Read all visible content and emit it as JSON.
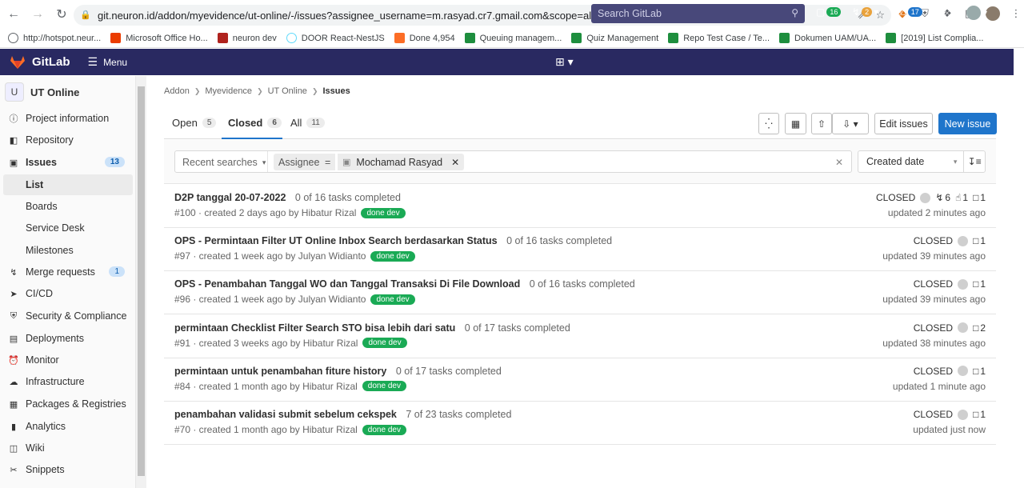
{
  "browser": {
    "url": "git.neuron.id/addon/myevidence/ut-online/-/issues?assignee_username=m.rasyad.cr7.gmail.com&scope=all&sort=created_date&state=closed",
    "bookmarks": [
      {
        "label": "http://hotspot.neur...",
        "color": "#5f6368"
      },
      {
        "label": "Microsoft Office Ho...",
        "color": "#eb3c00"
      },
      {
        "label": "neuron dev",
        "color": "#b0231e"
      },
      {
        "label": "DOOR React-NestJS",
        "color": "#61dafb"
      },
      {
        "label": "Done 4,954",
        "color": "#fc6d26"
      },
      {
        "label": "Queuing managem...",
        "color": "#1e8e3e"
      },
      {
        "label": "Quiz Management",
        "color": "#1e8e3e"
      },
      {
        "label": "Repo Test Case / Te...",
        "color": "#1e8e3e"
      },
      {
        "label": "Dokumen UAM/UA...",
        "color": "#1e8e3e"
      },
      {
        "label": "[2019] List Complia...",
        "color": "#1e8e3e"
      }
    ]
  },
  "header": {
    "brand": "GitLab",
    "menu": "Menu",
    "search_placeholder": "Search GitLab",
    "issues_count": "16",
    "mr_count": "2",
    "todo_count": "17",
    "colors": {
      "bg": "#292961",
      "green": "#1aaa55",
      "orange": "#e9a23b",
      "blue": "#1f75cb"
    }
  },
  "sidebar": {
    "project_initial": "U",
    "project_name": "UT Online",
    "items": [
      {
        "label": "Project information",
        "icon": "info-icon"
      },
      {
        "label": "Repository",
        "icon": "repo-icon"
      },
      {
        "label": "Issues",
        "icon": "issues-icon",
        "badge": "13"
      },
      {
        "label": "Merge requests",
        "icon": "merge-request-icon",
        "badge": "1"
      },
      {
        "label": "CI/CD",
        "icon": "rocket-icon"
      },
      {
        "label": "Security & Compliance",
        "icon": "shield-icon"
      },
      {
        "label": "Deployments",
        "icon": "deployments-icon"
      },
      {
        "label": "Monitor",
        "icon": "monitor-icon"
      },
      {
        "label": "Infrastructure",
        "icon": "cloud-icon"
      },
      {
        "label": "Packages & Registries",
        "icon": "package-icon"
      },
      {
        "label": "Analytics",
        "icon": "chart-icon"
      },
      {
        "label": "Wiki",
        "icon": "book-icon"
      },
      {
        "label": "Snippets",
        "icon": "scissors-icon"
      }
    ],
    "issues_sub": [
      "List",
      "Boards",
      "Service Desk",
      "Milestones"
    ]
  },
  "breadcrumb": [
    "Addon",
    "Myevidence",
    "UT Online",
    "Issues"
  ],
  "tabs": [
    {
      "label": "Open",
      "count": "5"
    },
    {
      "label": "Closed",
      "count": "6"
    },
    {
      "label": "All",
      "count": "11"
    }
  ],
  "actions": {
    "edit": "Edit issues",
    "new": "New issue"
  },
  "filter": {
    "recent": "Recent searches",
    "token_key": "Assignee",
    "token_op": "=",
    "token_value": "Mochamad Rasyad",
    "sort": "Created date"
  },
  "issues": [
    {
      "title": "D2P tanggal 20-07-2022",
      "tasks": "0 of 16 tasks completed",
      "meta": "#100 · created 2 days ago by Hibatur Rizal",
      "label": "done dev",
      "status": "CLOSED",
      "mrs": "6",
      "upvotes": "1",
      "comments": "1",
      "updated": "updated 2 minutes ago"
    },
    {
      "title": "OPS - Permintaan Filter UT Online Inbox Search berdasarkan Status",
      "tasks": "0 of 16 tasks completed",
      "meta": "#97 · created 1 week ago by Julyan Widianto",
      "label": "done dev",
      "status": "CLOSED",
      "comments": "1",
      "updated": "updated 39 minutes ago"
    },
    {
      "title": "OPS - Penambahan Tanggal WO dan Tanggal Transaksi Di File Download",
      "tasks": "0 of 16 tasks completed",
      "meta": "#96 · created 1 week ago by Julyan Widianto",
      "label": "done dev",
      "status": "CLOSED",
      "comments": "1",
      "updated": "updated 39 minutes ago"
    },
    {
      "title": "permintaan Checklist Filter Search STO bisa lebih dari satu",
      "tasks": "0 of 17 tasks completed",
      "meta": "#91 · created 3 weeks ago by Hibatur Rizal",
      "label": "done dev",
      "status": "CLOSED",
      "comments": "2",
      "updated": "updated 38 minutes ago"
    },
    {
      "title": "permintaan untuk penambahan fiture history",
      "tasks": "0 of 17 tasks completed",
      "meta": "#84 · created 1 month ago by Hibatur Rizal",
      "label": "done dev",
      "status": "CLOSED",
      "comments": "1",
      "updated": "updated 1 minute ago"
    },
    {
      "title": "penambahan validasi submit sebelum cekspek",
      "tasks": "7 of 23 tasks completed",
      "meta": "#70 · created 1 month ago by Hibatur Rizal",
      "label": "done dev",
      "status": "CLOSED",
      "comments": "1",
      "updated": "updated just now"
    }
  ]
}
